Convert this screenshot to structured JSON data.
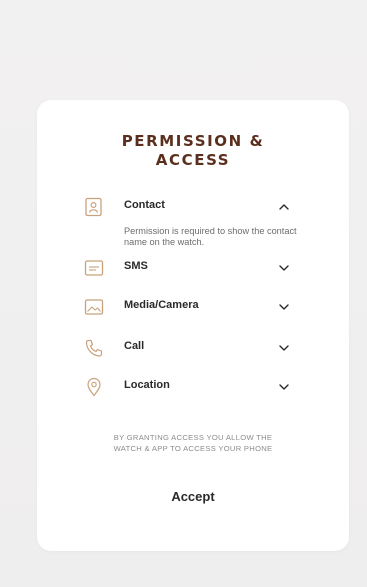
{
  "title": {
    "line1": "PERMISSION &",
    "line2": "ACCESS"
  },
  "permissions": [
    {
      "label": "Contact",
      "icon": "contact-icon",
      "expanded": true,
      "description": "Permission is required to show the contact name on the watch."
    },
    {
      "label": "SMS",
      "icon": "sms-icon",
      "expanded": false
    },
    {
      "label": "Media/Camera",
      "icon": "media-icon",
      "expanded": false
    },
    {
      "label": "Call",
      "icon": "phone-icon",
      "expanded": false
    },
    {
      "label": "Location",
      "icon": "location-pin-icon",
      "expanded": false
    }
  ],
  "notice": {
    "line1": "BY GRANTING ACCESS YOU ALLOW THE",
    "line2": "WATCH & APP TO ACCESS YOUR PHONE"
  },
  "accept_label": "Accept",
  "colors": {
    "accent": "#c8a27c",
    "title": "#5b2f1e",
    "text": "#2a2a2a",
    "muted": "#8c8c8c",
    "background": "#f0efef",
    "card": "#ffffff"
  }
}
